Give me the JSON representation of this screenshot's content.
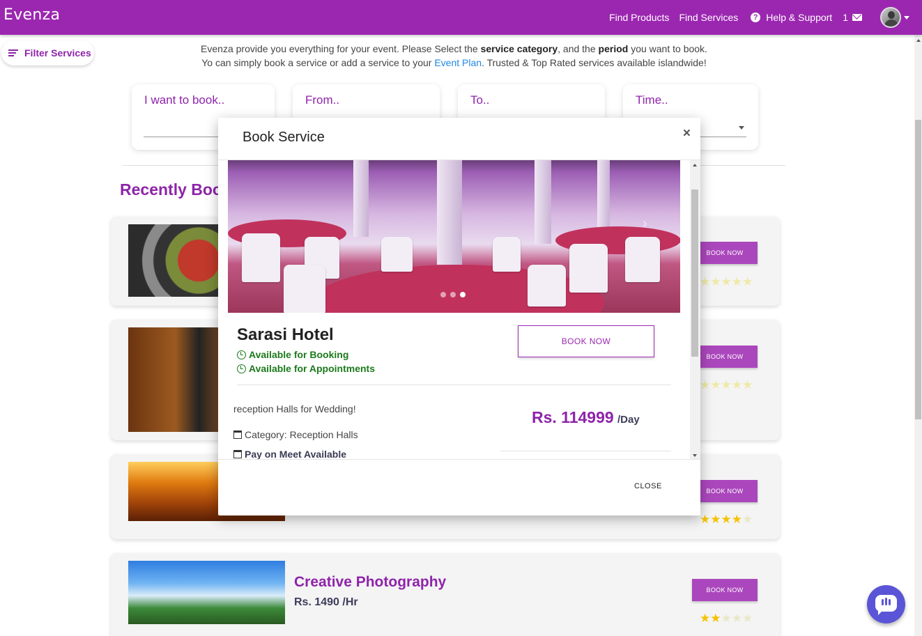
{
  "navbar": {
    "brand": "Evenza",
    "links": [
      "Find Products",
      "Find Services"
    ],
    "help_label": "Help & Support",
    "help_icon": "?",
    "message_count": "1",
    "accent_color": "#9b27b0"
  },
  "filter": {
    "label": "Filter Services"
  },
  "intro": {
    "line1_a": "Evenza provide you everything for your event. Please Select the ",
    "line1_b": "service category",
    "line1_c": ", and the ",
    "line1_d": "period",
    "line1_e": " you want to book.",
    "line2_a": "Yo can simply book a service or add a service to your ",
    "line2_link": "Event Plan",
    "line2_b": ". Trusted & Top Rated services available islandwide!"
  },
  "search": {
    "service": "I want to book..",
    "from": "From..",
    "to": "To..",
    "time": "Time.."
  },
  "section_title": "Recently Boo",
  "services": [
    {
      "name": "",
      "price": "",
      "book_label": "BOOK NOW",
      "rating": 5,
      "image": "food"
    },
    {
      "name": "",
      "price": "",
      "book_label": "BOOK NOW",
      "rating": 5,
      "image": "camera"
    },
    {
      "name": "",
      "price": "",
      "book_label": "BOOK NOW",
      "rating": 4,
      "image": "hall"
    },
    {
      "name": "Creative Photography",
      "price": "Rs. 1490 /Hr",
      "book_label": "BOOK NOW",
      "rating": 2,
      "image": "photo"
    }
  ],
  "modal": {
    "title": "Book Service",
    "close_x": "×",
    "carousel_slides": 3,
    "carousel_active": 3,
    "hotel_name": "Sarasi Hotel",
    "availability": [
      "Available for Booking",
      "Available for Appointments"
    ],
    "book_label": "BOOK NOW",
    "description": "reception Halls for Wedding!",
    "category": "Category: Reception Halls",
    "pay": "Pay on Meet Available",
    "price": "Rs. 114999",
    "per": "/Day",
    "close_label": "CLOSE"
  }
}
